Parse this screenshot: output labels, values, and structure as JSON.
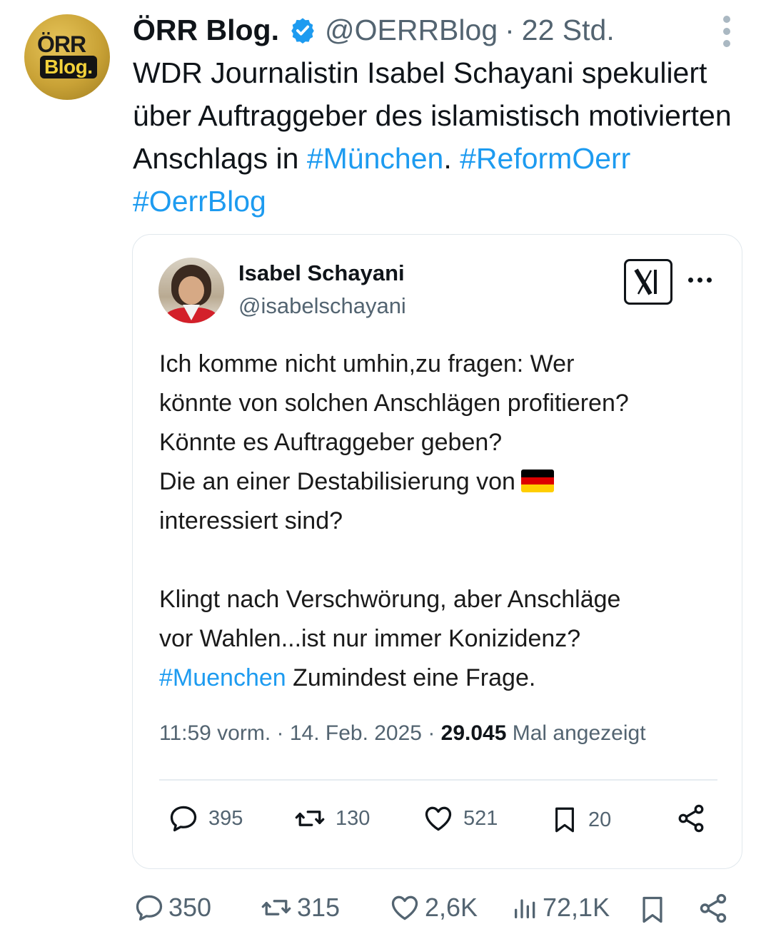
{
  "tweet": {
    "author": {
      "avatar_line1": "ÖRR",
      "avatar_line2": "Blog.",
      "display_name": "ÖRR Blog.",
      "handle": "@OERRBlog",
      "separator": "·",
      "time": "22 Std.",
      "verified_icon": "verified-badge-icon"
    },
    "text": {
      "body": "WDR Journalistin Isabel Schayani spekuliert über Auftraggeber des islamistisch motivierten Anschlags in ",
      "hashtag1": "#München",
      "after_hashtag1": ". ",
      "hashtag2": "#ReformOerr",
      "space": " ",
      "hashtag3": "#OerrBlog"
    },
    "quoted": {
      "display_name": "Isabel Schayani",
      "handle": "@isabelschayani",
      "x_logo_text": "X",
      "lines": [
        "Ich komme nicht umhin,zu fragen: Wer",
        "könnte von solchen Anschlägen profitieren?",
        "Könnte es Auftraggeber geben?",
        "Die an einer Destabilisierung von",
        "interessiert sind?",
        "Klingt nach Verschwörung, aber Anschläge",
        "vor Wahlen...ist nur immer Konizidenz?"
      ],
      "flag": "flag-germany",
      "hashtag": "#Muenchen",
      "last_line_rest": " Zumindest eine Frage.",
      "meta_time": "11:59 vorm. · 14. Feb. 2025 · ",
      "meta_views": "29.045",
      "meta_views_label": " Mal angezeigt",
      "actions": {
        "replies": "395",
        "retweets": "130",
        "likes": "521",
        "bookmarks": "20"
      }
    },
    "actions": {
      "replies": "350",
      "retweets": "315",
      "likes": "2,6K",
      "views": "72,1K"
    },
    "colors": {
      "link": "#1d9bf0",
      "muted": "#536471",
      "text": "#0f1419",
      "flag": [
        "#000000",
        "#dd0000",
        "#ffce00"
      ]
    }
  }
}
